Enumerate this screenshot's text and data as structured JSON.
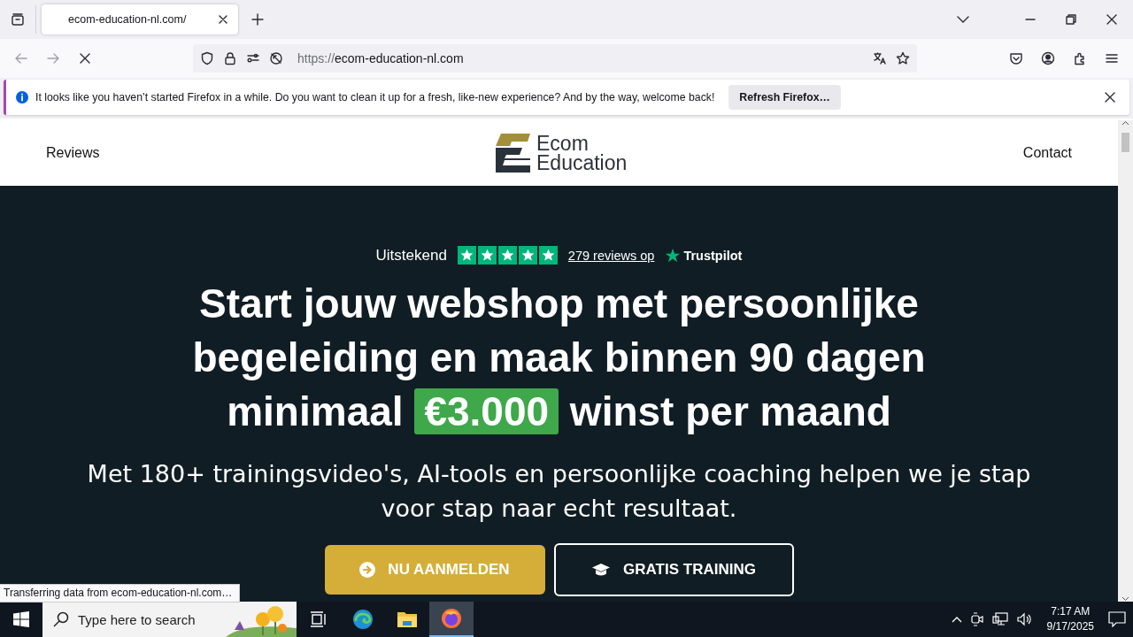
{
  "browser": {
    "tabs": [
      {
        "label": "ecom-education-nl.com/",
        "selected": true
      }
    ],
    "address": {
      "scheme": "https://",
      "host": "ecom-education-nl.com"
    },
    "notification": {
      "message": "It looks like you haven’t started Firefox in a while. Do you want to clean it up for a fresh, like-new experience? And by the way, welcome back!",
      "button": "Refresh Firefox…"
    },
    "status": "Transferring data from ecom-education-nl.com…"
  },
  "site": {
    "nav": [
      {
        "label": "Reviews"
      },
      {
        "label": "Contact"
      }
    ],
    "logo": [
      "Ecom",
      "Education"
    ],
    "rating": {
      "label": "Uitstekend",
      "stars": 5,
      "reviews": "279 reviews op",
      "brand": "Trustpilot"
    },
    "headline": {
      "before": "Start jouw webshop met persoonlijke begeleiding en maak binnen 90 dagen minimaal ",
      "highlight": "€3.000",
      "after": " winst per maand"
    },
    "subtitle": "Met 180+ trainingsvideo's, AI-tools en persoonlijke coaching helpen we je stap voor stap naar echt resultaat.",
    "buttons": [
      {
        "label": "NU AANMELDEN",
        "kind": "primary"
      },
      {
        "label": "GRATIS TRAINING",
        "kind": "outline"
      }
    ]
  },
  "taskbar": {
    "search_placeholder": "Type here to search",
    "time": "7:17 AM",
    "date": "9/17/2025"
  }
}
